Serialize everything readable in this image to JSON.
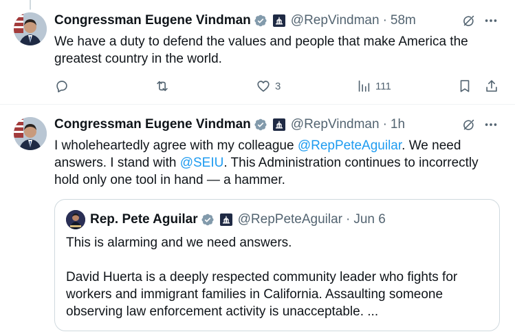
{
  "tweet1": {
    "author_name": "Congressman Eugene Vindman",
    "handle": "@RepVindman",
    "time": "58m",
    "text": "We have a duty to defend the values and people that make America the greatest country in the world.",
    "actions": {
      "reply_count": "",
      "retweet_count": "",
      "like_count": "3",
      "views_count": "111"
    }
  },
  "tweet2": {
    "author_name": "Congressman Eugene Vindman",
    "handle": "@RepVindman",
    "time": "1h",
    "text_parts": {
      "p1": "I wholeheartedly agree with my colleague ",
      "mention1": "@RepPeteAguilar",
      "p2": ". We need answers. I stand with ",
      "mention2": "@SEIU",
      "p3": ". This Administration continues to incorrectly hold only one tool in hand — a hammer."
    },
    "quote": {
      "author_name": "Rep. Pete Aguilar",
      "handle": "@RepPeteAguilar",
      "time": "Jun 6",
      "paragraph1": "This is alarming and we need answers.",
      "paragraph2": "David Huerta is a deeply respected community leader who fights for workers and immigrant families in California. Assaulting someone observing law enforcement activity is unacceptable. ..."
    }
  },
  "separator": "·",
  "colors": {
    "text": "#0f1419",
    "secondary": "#536471",
    "link": "#1d9bf0",
    "verified": "#829aab",
    "border": "#cfd9de"
  },
  "icons": {
    "verified": "verified-badge-icon",
    "affiliation": "capitol-affiliation-icon",
    "grok": "grok-icon",
    "more": "more-icon",
    "reply": "reply-icon",
    "retweet": "retweet-icon",
    "like": "heart-icon",
    "views": "views-icon",
    "bookmark": "bookmark-icon",
    "share": "share-icon"
  }
}
